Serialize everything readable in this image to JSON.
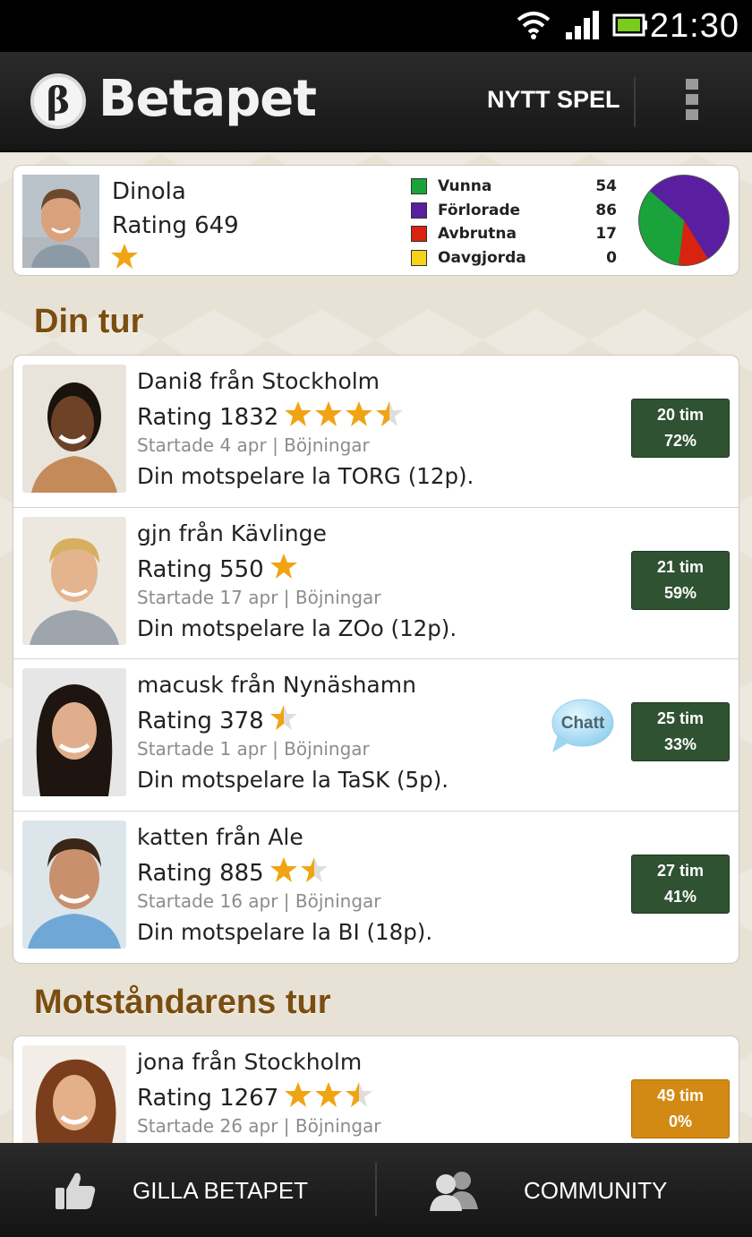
{
  "status_bar": {
    "time": "21:30"
  },
  "app_bar": {
    "title": "Betapet",
    "logo_glyph": "β",
    "new_game": "NYTT SPEL"
  },
  "profile": {
    "name": "Dinola",
    "rating": "Rating 649",
    "stats": [
      {
        "label": "Vunna",
        "value": "54",
        "color": "#1aa33a"
      },
      {
        "label": "Förlorade",
        "value": "86",
        "color": "#5a1fa0"
      },
      {
        "label": "Avbrutna",
        "value": "17",
        "color": "#d8230f"
      },
      {
        "label": "Oavgjorda",
        "value": "0",
        "color": "#f6d21a"
      }
    ]
  },
  "sections": {
    "your_turn": "Din tur",
    "opponent_turn": "Motståndarens tur"
  },
  "your_turn_games": [
    {
      "name": "Dani8 från Stockholm",
      "rating": "Rating 1832",
      "stars": 3.5,
      "started": "Startade 4 apr | Böjningar",
      "last_move": "Din motspelare la TORG (12p).",
      "time": "20 tim",
      "percent": "72%"
    },
    {
      "name": "gjn från Kävlinge",
      "rating": "Rating 550",
      "stars": 1,
      "started": "Startade 17 apr | Böjningar",
      "last_move": "Din motspelare la ZOo (12p).",
      "time": "21 tim",
      "percent": "59%"
    },
    {
      "name": "macusk från Nynäshamn",
      "rating": "Rating 378",
      "stars": 0.5,
      "started": "Startade 1 apr | Böjningar",
      "last_move": "Din motspelare la TaSK (5p).",
      "time": "25 tim",
      "percent": "33%",
      "chat": "Chatt"
    },
    {
      "name": "katten från Ale",
      "rating": "Rating 885",
      "stars": 1.5,
      "started": "Startade 16 apr | Böjningar",
      "last_move": "Din motspelare la BI (18p).",
      "time": "27 tim",
      "percent": "41%"
    }
  ],
  "opponent_turn_games": [
    {
      "name": "jona från Stockholm",
      "rating": "Rating 1267",
      "stars": 2.5,
      "started": "Startade 26 apr | Böjningar",
      "time": "49 tim",
      "percent": "0%"
    }
  ],
  "bottom_bar": {
    "like": "GILLA BETAPET",
    "community": "COMMUNITY"
  }
}
